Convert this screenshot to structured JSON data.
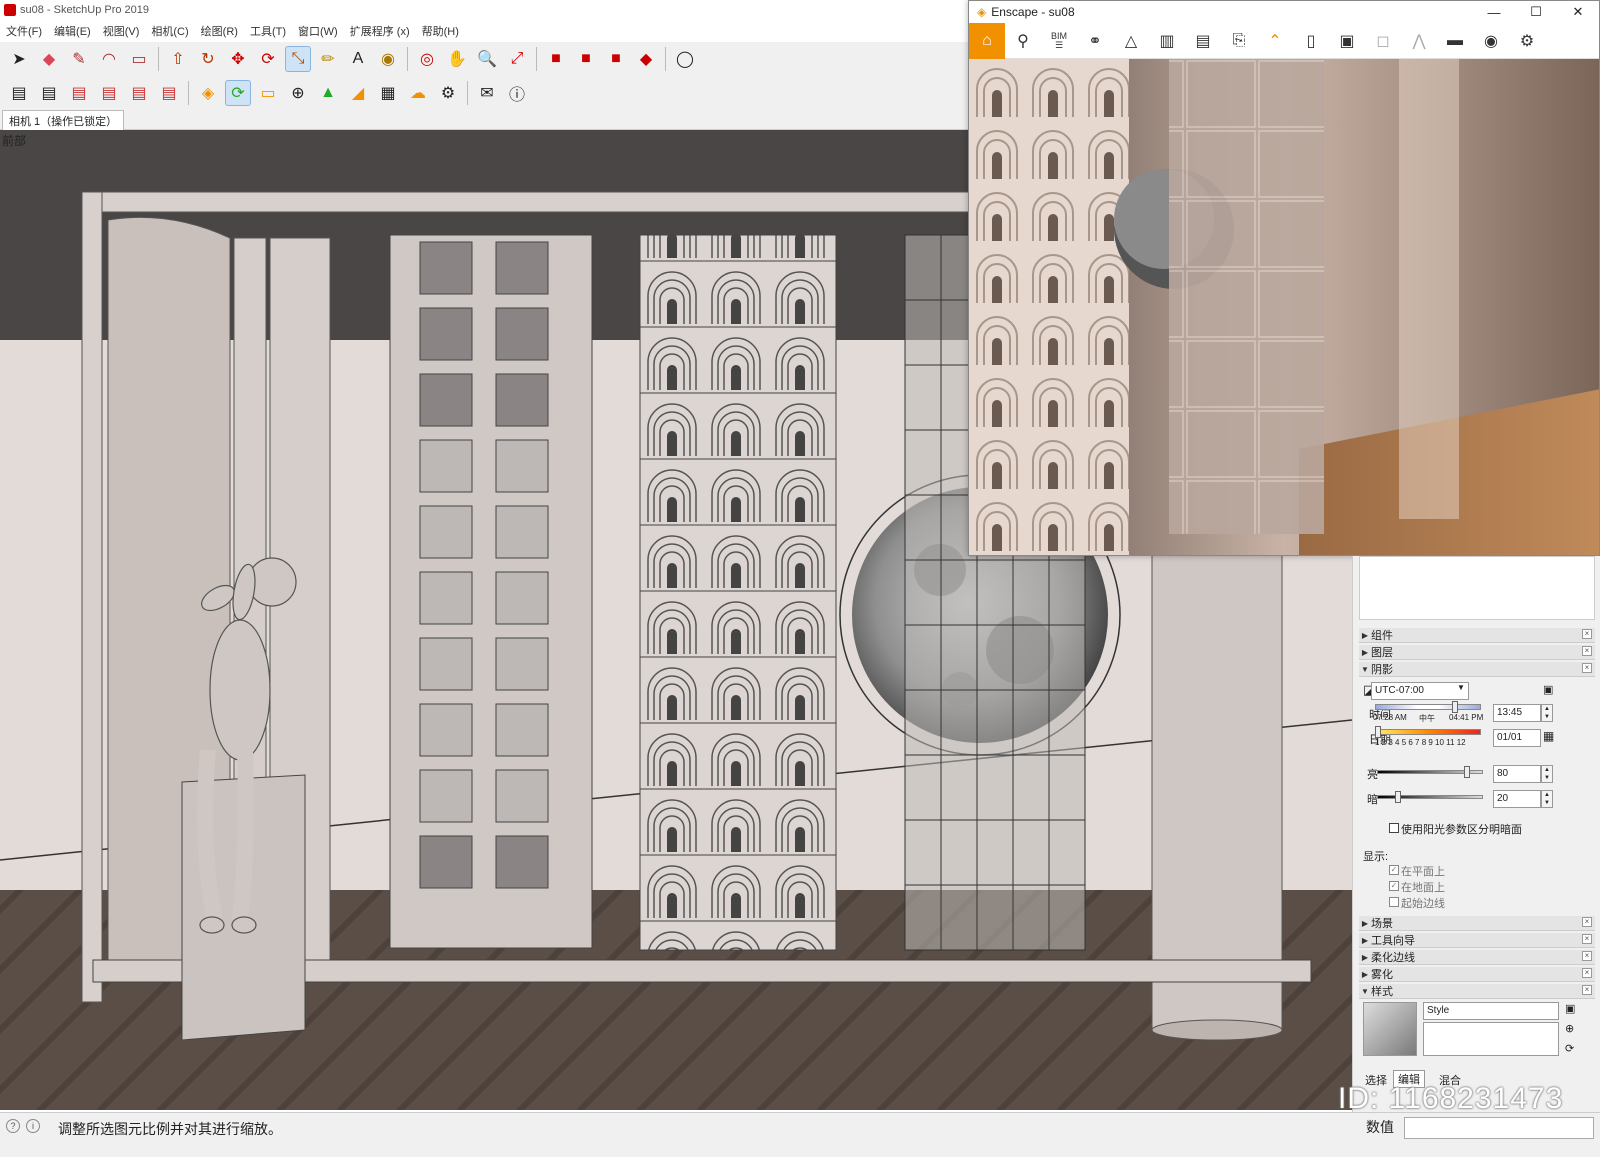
{
  "sketchup": {
    "title": "su08 - SketchUp Pro 2019",
    "menu": [
      "文件(F)",
      "编辑(E)",
      "视图(V)",
      "相机(C)",
      "绘图(R)",
      "工具(T)",
      "窗口(W)",
      "扩展程序 (x)",
      "帮助(H)"
    ],
    "scene_tab": "相机 1（操作已锁定）",
    "view_label": "前部",
    "status_text": "调整所选图元比例并对其进行缩放。",
    "value_label": "数值",
    "value": ""
  },
  "enscape": {
    "title": "Enscape - su08",
    "bim_label": "BIM",
    "controls": [
      "—",
      "☐",
      "✕"
    ]
  },
  "tray": {
    "sections_top": [
      "组件",
      "图层",
      "阴影"
    ],
    "timezone": "UTC-07:00",
    "time_label": "时间",
    "time_start": "07:28 AM",
    "time_mid": "中午",
    "time_end": "04:41 PM",
    "time_value": "13:45",
    "date_label": "日期",
    "date_ticks": "1 2 3 4 5 6 7 8 9 10 11 12",
    "date_value": "01/01",
    "light_label": "亮",
    "light_value": "80",
    "light_level": 0.85,
    "dark_label": "暗",
    "dark_value": "20",
    "dark_level": 0.2,
    "use_sun_label": "使用阳光参数区分明暗面",
    "display_label": "显示:",
    "display_options": [
      "在平面上",
      "在地面上",
      "起始边线"
    ],
    "sections_bottom": [
      "场景",
      "工具向导",
      "柔化边线",
      "雾化",
      "样式"
    ],
    "style_name": "Style",
    "style_tabs": [
      "选择",
      "编辑",
      "混合"
    ]
  },
  "watermark": "ID: 1168231473"
}
